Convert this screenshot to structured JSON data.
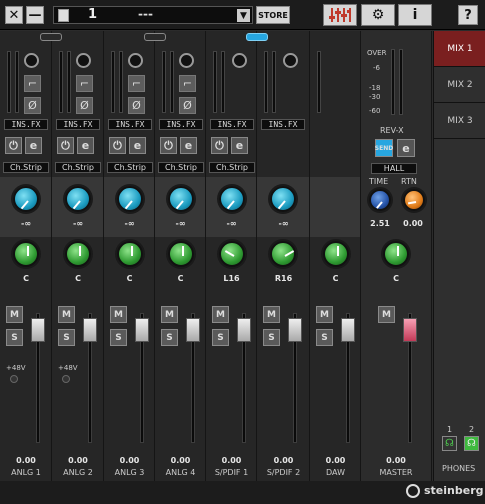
{
  "window": {
    "close": "✕",
    "minimize": "—",
    "help": "?"
  },
  "scene": {
    "number": "1",
    "name": "---",
    "store": "STORE"
  },
  "views": {
    "mixer": "mixer-icon",
    "settings": "gear-icon",
    "info": "i"
  },
  "channels": [
    {
      "name": "ANLG 1",
      "insert": "INS.FX",
      "strip": "Ch.Strip",
      "send": "-∞",
      "pan": "C",
      "level": "0.00",
      "phantom": "+48V"
    },
    {
      "name": "ANLG 2",
      "insert": "INS.FX",
      "strip": "Ch.Strip",
      "send": "-∞",
      "pan": "C",
      "level": "0.00",
      "phantom": "+48V"
    },
    {
      "name": "ANLG 3",
      "insert": "INS.FX",
      "strip": "Ch.Strip",
      "send": "-∞",
      "pan": "C",
      "level": "0.00"
    },
    {
      "name": "ANLG 4",
      "insert": "INS.FX",
      "strip": "Ch.Strip",
      "send": "-∞",
      "pan": "C",
      "level": "0.00"
    },
    {
      "name": "S/PDIF 1",
      "insert": "INS.FX",
      "strip": "Ch.Strip",
      "send": "-∞",
      "pan": "L16",
      "level": "0.00"
    },
    {
      "name": "S/PDIF 2",
      "insert": "INS.FX",
      "send": "-∞",
      "pan": "R16",
      "level": "0.00"
    },
    {
      "name": "DAW",
      "pan": "C",
      "level": "0.00"
    }
  ],
  "master": {
    "name": "MASTER",
    "pan": "C",
    "level": "0.00",
    "meter_scale": [
      "OVER",
      "-6",
      "-18",
      "-30",
      "-60"
    ],
    "reverb": {
      "title": "REV-X",
      "on_label": "SEND",
      "type": "HALL",
      "time_label": "TIME",
      "rtn_label": "RTN",
      "time": "2.51",
      "rtn": "0.00"
    }
  },
  "mix_tabs": [
    "MIX 1",
    "MIX 2",
    "MIX 3"
  ],
  "phones": {
    "label": "PHONES",
    "ch1": "1",
    "ch2": "2"
  },
  "footer": {
    "brand": "steinberg"
  },
  "buttons": {
    "mute": "M",
    "solo": "S",
    "edit": "e",
    "power": "⏻"
  }
}
